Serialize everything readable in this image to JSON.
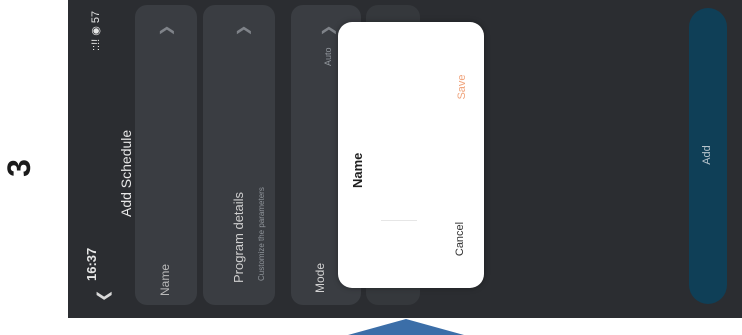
{
  "step": {
    "number": "3"
  },
  "status_bar": {
    "time": "16:37",
    "icons": "::!! ◉ 57"
  },
  "header": {
    "title": "Add Schedule"
  },
  "form": {
    "name_label": "Name",
    "program_label": "Program details",
    "program_subtitle": "Customize the parameters",
    "mode_label": "Mode",
    "mode_value": "Auto"
  },
  "dialog": {
    "title": "Name",
    "cancel_label": "Cancel",
    "save_label": "Save"
  },
  "footer": {
    "add_label": "Add"
  },
  "colors": {
    "background_dim": "#2b2d31",
    "card": "#3a3d42",
    "accent_save": "#f0a37b",
    "add_button": "#0f3f57",
    "arrow": "#3b6ea8"
  }
}
